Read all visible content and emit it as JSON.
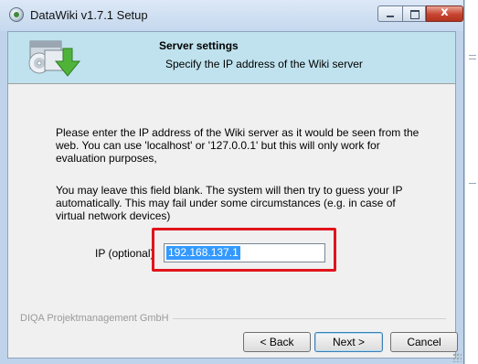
{
  "window": {
    "title": "DataWiki v1.7.1 Setup",
    "close_glyph": "x"
  },
  "header": {
    "title": "Server settings",
    "subtitle": "Specify the IP address of the Wiki server"
  },
  "body": {
    "paragraph1": "Please enter the IP address of the Wiki server as it would be seen from the web. You can use 'localhost' or '127.0.0.1' but this will only work for evaluation purposes,",
    "paragraph2": "You may leave this field blank. The system will then try to guess your IP automatically. This may fail under some circumstances (e.g. in case of virtual network devices)"
  },
  "ip_field": {
    "label": "IP (optional)",
    "value": "192.168.137.1",
    "highlight_color": "#e0141c"
  },
  "footer": {
    "brand": "DIQA Projektmanagement GmbH",
    "back_label": "< Back",
    "next_label": "Next >",
    "cancel_label": "Cancel"
  },
  "icons": {
    "app": "installer-globe-icon",
    "logo": "install-box-download-icon"
  },
  "colors": {
    "header_bg": "#bfe2ee",
    "selection": "#3399ff"
  }
}
